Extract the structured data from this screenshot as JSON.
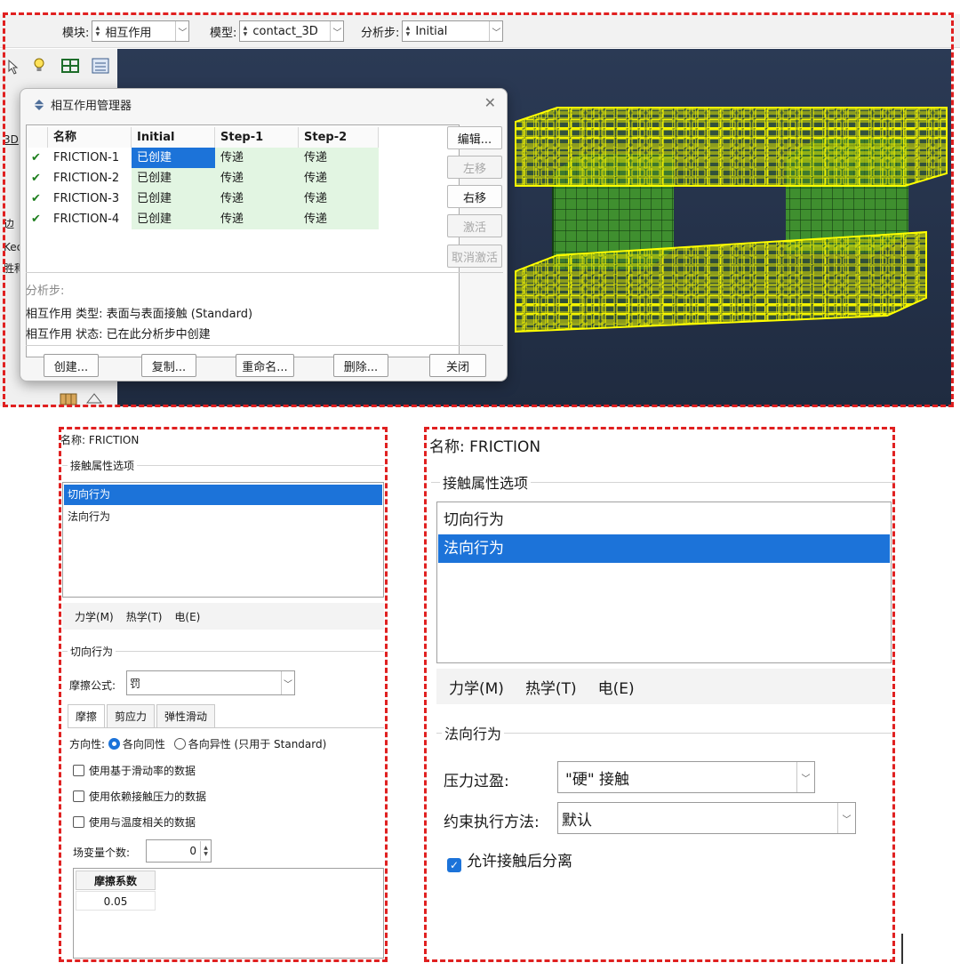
{
  "toolbar": {
    "module_label": "模块:",
    "module_value": "相互作用",
    "model_label": "模型:",
    "model_value": "contact_3D",
    "step_label": "分析步:",
    "step_value": "Initial"
  },
  "left_fragments": [
    "3D",
    "边",
    "Kec",
    "胜稈"
  ],
  "dialog": {
    "title": "相互作用管理器",
    "columns": [
      "名称",
      "Initial",
      "Step-1",
      "Step-2"
    ],
    "rows": [
      {
        "name": "FRICTION-1",
        "initial": "已创建",
        "step1": "传递",
        "step2": "传递"
      },
      {
        "name": "FRICTION-2",
        "initial": "已创建",
        "step1": "传递",
        "step2": "传递"
      },
      {
        "name": "FRICTION-3",
        "initial": "已创建",
        "step1": "传递",
        "step2": "传递"
      },
      {
        "name": "FRICTION-4",
        "initial": "已创建",
        "step1": "传递",
        "step2": "传递"
      }
    ],
    "side_buttons": {
      "edit": "编辑...",
      "move_left": "左移",
      "move_right": "右移",
      "activate": "激活",
      "deactivate": "取消激活"
    },
    "step_info": "分析步:",
    "type_info": "相互作用 类型: 表面与表面接触 (Standard)",
    "status_info": "相互作用 状态: 已在此分析步中创建",
    "bottom_buttons": {
      "create": "创建...",
      "copy": "复制...",
      "rename": "重命名...",
      "delete": "删除...",
      "close": "关闭"
    }
  },
  "left_panel": {
    "name_label": "名称:",
    "name_value": "FRICTION",
    "options_title": "接触属性选项",
    "options": [
      "切向行为",
      "法向行为"
    ],
    "selected_option": "切向行为",
    "menus": [
      "力学(M)",
      "热学(T)",
      "电(E)"
    ],
    "section_title": "切向行为",
    "friction_formula_label": "摩擦公式:",
    "friction_formula_value": "罚",
    "tabs": [
      "摩擦",
      "剪应力",
      "弹性滑动"
    ],
    "direction_label": "方向性:",
    "isotropic": "各向同性",
    "anisotropic": "各向异性 (只用于 Standard)",
    "checkboxes": [
      "使用基于滑动率的数据",
      "使用依赖接触压力的数据",
      "使用与温度相关的数据"
    ],
    "field_var_label": "场变量个数:",
    "field_var_value": "0",
    "table_header": "摩擦系数",
    "table_value": "0.05"
  },
  "right_panel": {
    "name_label": "名称:",
    "name_value": "FRICTION",
    "options_title": "接触属性选项",
    "options": [
      "切向行为",
      "法向行为"
    ],
    "selected_option": "法向行为",
    "menus": [
      "力学(M)",
      "热学(T)",
      "电(E)"
    ],
    "section_title": "法向行为",
    "pressure_label": "压力过盈:",
    "pressure_value": "\"硬\" 接触",
    "constraint_label": "约束执行方法:",
    "constraint_value": "默认",
    "allow_separation": "允许接触后分离"
  },
  "colors": {
    "accent": "#1c73d9",
    "mesh_green": "#3f8f2f",
    "mesh_yellow": "#ffff00",
    "viewport_bg": "#243048",
    "dash_red": "#e02020"
  }
}
